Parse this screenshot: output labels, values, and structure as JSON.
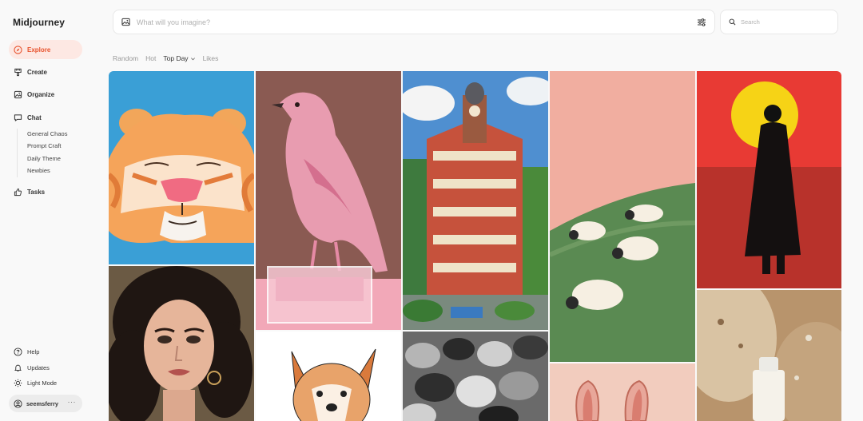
{
  "app": {
    "title": "Midjourney"
  },
  "nav": {
    "items": [
      {
        "label": "Explore",
        "icon": "compass-icon",
        "active": true
      },
      {
        "label": "Create",
        "icon": "brush-icon"
      },
      {
        "label": "Organize",
        "icon": "image-icon"
      },
      {
        "label": "Chat",
        "icon": "chat-icon"
      }
    ],
    "chat_rooms": [
      "General Chaos",
      "Prompt Craft",
      "Daily Theme",
      "Newbies"
    ],
    "tasks": {
      "label": "Tasks",
      "icon": "thumbs-up-icon"
    }
  },
  "footer": {
    "help": "Help",
    "updates": "Updates",
    "light_mode": "Light Mode",
    "user": "seemsferry",
    "more": "···"
  },
  "prompt": {
    "placeholder": "What will you imagine?"
  },
  "search": {
    "placeholder": "Search"
  },
  "filters": {
    "tabs": [
      "Random",
      "Hot",
      "Top Day",
      "Likes"
    ],
    "active": "Top Day"
  },
  "colors": {
    "accent": "#e8542f",
    "accent_bg": "#fde8e3"
  },
  "gallery": {
    "images": [
      {
        "name": "tiger-face-illustration"
      },
      {
        "name": "woman-curly-hair-portrait"
      },
      {
        "name": "pink-glass-bird-sculpture"
      },
      {
        "name": "dog-sketch-drawing"
      },
      {
        "name": "ornate-city-building"
      },
      {
        "name": "crowd-black-white-motion"
      },
      {
        "name": "sheep-on-green-hill"
      },
      {
        "name": "rabbit-ears-pink"
      },
      {
        "name": "man-silhouette-red-sun"
      },
      {
        "name": "serum-bottle-stone"
      }
    ]
  }
}
